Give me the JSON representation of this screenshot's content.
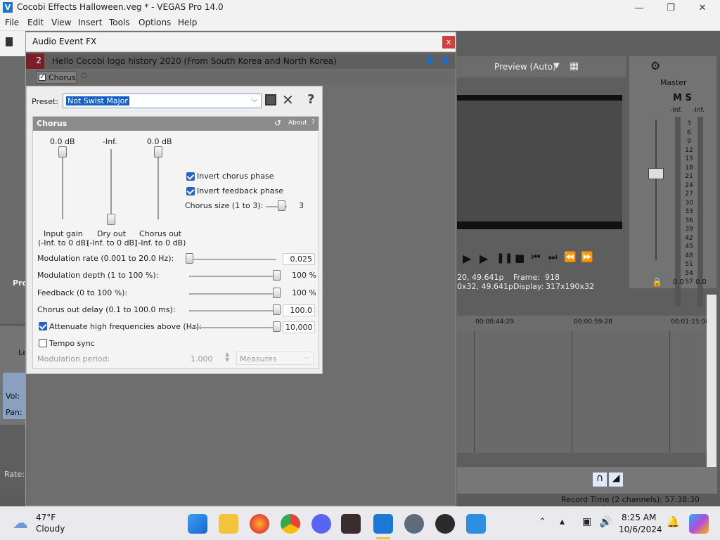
{
  "app": {
    "title": "Cocobi Effects Halloween.veg * - VEGAS Pro 14.0",
    "menu": [
      "File",
      "Edit",
      "View",
      "Insert",
      "Tools",
      "Options",
      "Help"
    ],
    "preview_label": "Preview (Auto)",
    "master_label": "Master",
    "ms_label": "M S",
    "side_label": "Pro",
    "le_label": "Le",
    "vol_label": "Vol:",
    "pan_label": "Pan:",
    "rate_label": "Rate:",
    "record_time": "Record Time (2 channels): 57:38:30",
    "timecodes": [
      "00:00:44:29",
      "00:00:59:28",
      "00:01:15:00"
    ],
    "preview_info": {
      "line1_left": "20, 49.641p",
      "line2_left": "0x32, 49.641p",
      "frame_label": "Frame:",
      "frame_value": "918",
      "display_label": "Display:",
      "display_value": "317x190x32"
    },
    "meter": {
      "top_left": "-Inf.",
      "top_right": "-Inf.",
      "scale": [
        "3",
        "6",
        "9",
        "12",
        "15",
        "18",
        "21",
        "24",
        "27",
        "30",
        "33",
        "36",
        "39",
        "42",
        "45",
        "48",
        "51",
        "54",
        "57"
      ],
      "bottom_left": "0.0",
      "bottom_right": "0.0"
    }
  },
  "dialog": {
    "title": "Audio Event FX",
    "close": "x",
    "track_number": "2",
    "event_name": "Hello Cocobi logo history 2020 (From South Korea and North Korea)",
    "plugin_chip": "Chorus",
    "preset_label": "Preset:",
    "preset_value": "Not Swist Major",
    "help": "?",
    "plugin": {
      "name": "Chorus",
      "about": "About",
      "help": "?",
      "sliders_vertical": [
        {
          "top": "0.0 dB",
          "label": "Input gain",
          "range": "(-Inf. to 0 dB)"
        },
        {
          "top": "-Inf.",
          "label": "Dry out",
          "range": "(-Inf. to 0 dB)"
        },
        {
          "top": "0.0 dB",
          "label": "Chorus out",
          "range": "(-Inf. to 0 dB)"
        }
      ],
      "invert_chorus_phase": "Invert chorus phase",
      "invert_feedback_phase": "Invert feedback phase",
      "chorus_size_label": "Chorus size (1 to 3):",
      "chorus_size_value": "3",
      "params": [
        {
          "label": "Modulation rate (0.001 to 20.0 Hz):",
          "value": "0.025"
        },
        {
          "label": "Modulation depth (1 to 100 %):",
          "value": "100 %"
        },
        {
          "label": "Feedback (0 to 100 %):",
          "value": "100 %"
        },
        {
          "label": "Chorus out delay (0.1 to 100.0 ms):",
          "value": "100.0"
        },
        {
          "label": "Attenuate high frequencies above (Hz):",
          "value": "10,000"
        }
      ],
      "tempo_sync": "Tempo sync",
      "modulation_period_label": "Modulation period:",
      "modulation_period_value": "1.000",
      "measures": "Measures"
    }
  },
  "taskbar": {
    "weather_temp": "47°F",
    "weather_desc": "Cloudy",
    "time": "8:25 AM",
    "date": "10/6/2024"
  },
  "colors": {
    "accent": "#2563c7",
    "dialog_bg": "#6e6e6e",
    "close_red": "#d04040",
    "header_gray": "#8c8c8c"
  }
}
